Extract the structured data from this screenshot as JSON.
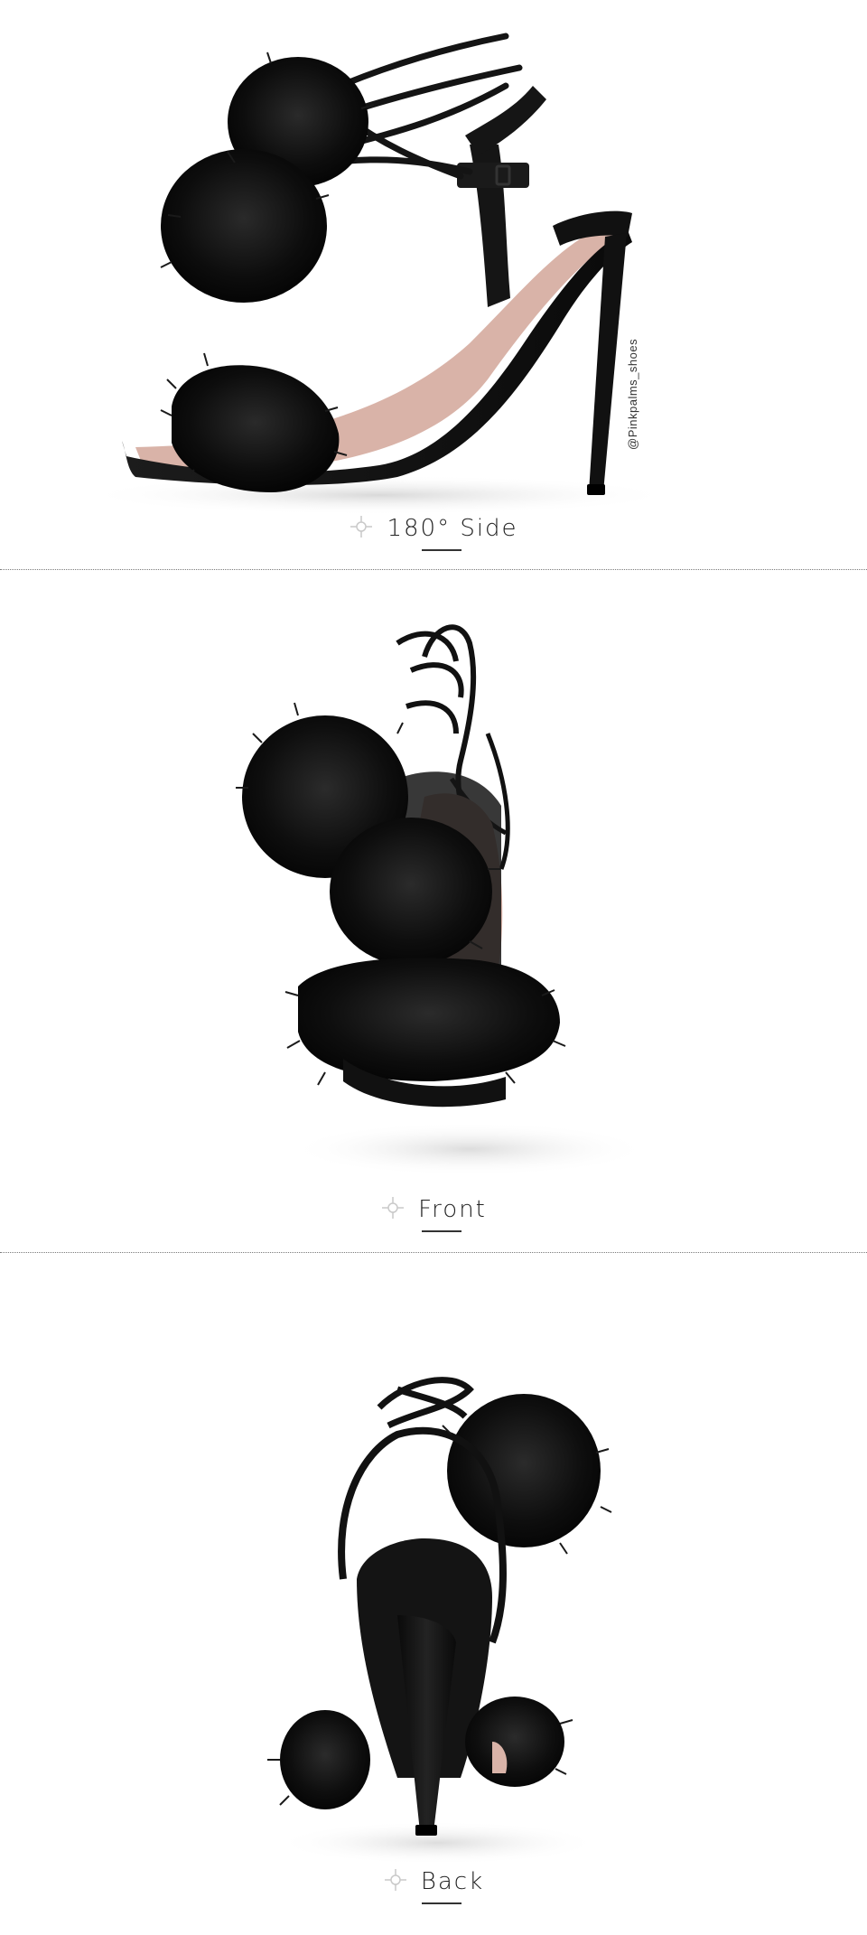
{
  "panels": [
    {
      "id": "side",
      "caption": "180° Side",
      "watermark": "@Pinkpalms_shoes"
    },
    {
      "id": "front",
      "caption": "Front"
    },
    {
      "id": "back",
      "caption": "Back"
    }
  ],
  "icons": {
    "caption_marker": "crosshair-icon"
  },
  "colors": {
    "background": "#ffffff",
    "shoe": "#111111",
    "fur": "#0c0c0c",
    "lining": "#d9b3a8",
    "divider": "#7a7a7a"
  }
}
